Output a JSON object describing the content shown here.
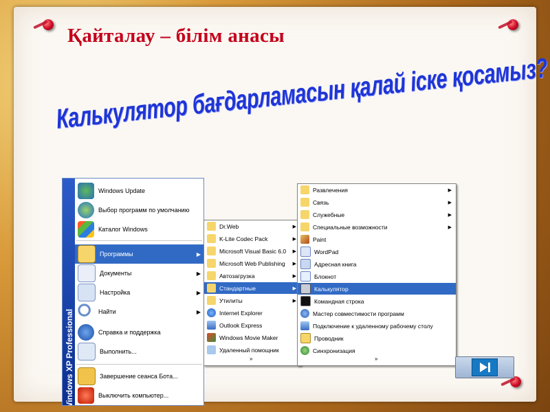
{
  "slide": {
    "title": "Қайталау – білім анасы",
    "question": "Калькулятор бағдарламасын қалай іске қосамыз?"
  },
  "start_menu": {
    "brand": "Windows XP Professional",
    "items": [
      {
        "label": "Windows Update",
        "icon": "windows-update-icon"
      },
      {
        "label": "Выбор программ по умолчанию",
        "icon": "default-programs-icon"
      },
      {
        "label": "Каталог Windows",
        "icon": "windows-catalog-icon"
      },
      {
        "label": "Программы",
        "icon": "programs-folder-icon",
        "selected": true,
        "has_submenu": true
      },
      {
        "label": "Документы",
        "icon": "documents-icon",
        "has_submenu": true
      },
      {
        "label": "Настройка",
        "icon": "settings-icon",
        "has_submenu": true
      },
      {
        "label": "Найти",
        "icon": "search-icon",
        "has_submenu": true
      },
      {
        "label": "Справка и поддержка",
        "icon": "help-icon"
      },
      {
        "label": "Выполнить...",
        "icon": "run-icon"
      },
      {
        "label": "Завершение сеанса Бота...",
        "icon": "logoff-icon"
      },
      {
        "label": "Выключить компьютер...",
        "icon": "shutdown-icon"
      }
    ]
  },
  "programs_menu": {
    "items": [
      {
        "label": "Dr.Web",
        "has_submenu": true
      },
      {
        "label": "K-Lite Codec Pack",
        "has_submenu": true
      },
      {
        "label": "Microsoft Visual Basic 6.0",
        "has_submenu": true
      },
      {
        "label": "Microsoft Web Publishing",
        "has_submenu": true
      },
      {
        "label": "Автозагрузка",
        "has_submenu": true
      },
      {
        "label": "Стандартные",
        "has_submenu": true,
        "selected": true
      },
      {
        "label": "Утилиты",
        "has_submenu": true
      },
      {
        "label": "Internet Explorer"
      },
      {
        "label": "Outlook Express"
      },
      {
        "label": "Windows Movie Maker"
      },
      {
        "label": "Удаленный помощник"
      }
    ],
    "more": "»"
  },
  "accessories_menu": {
    "items": [
      {
        "label": "Развлечения",
        "has_submenu": true
      },
      {
        "label": "Связь",
        "has_submenu": true
      },
      {
        "label": "Служебные",
        "has_submenu": true
      },
      {
        "label": "Специальные возможности",
        "has_submenu": true
      },
      {
        "label": "Paint"
      },
      {
        "label": "WordPad"
      },
      {
        "label": "Адресная книга"
      },
      {
        "label": "Блокнот"
      },
      {
        "label": "Калькулятор",
        "selected": true
      },
      {
        "label": "Командная строка"
      },
      {
        "label": "Мастер совместимости программ"
      },
      {
        "label": "Подключение к удаленному рабочему столу"
      },
      {
        "label": "Проводник"
      },
      {
        "label": "Синхронизация"
      }
    ],
    "more": "»"
  },
  "colors": {
    "title": "#c4001a",
    "question": "#1f35d6",
    "selection": "#316ac5"
  }
}
